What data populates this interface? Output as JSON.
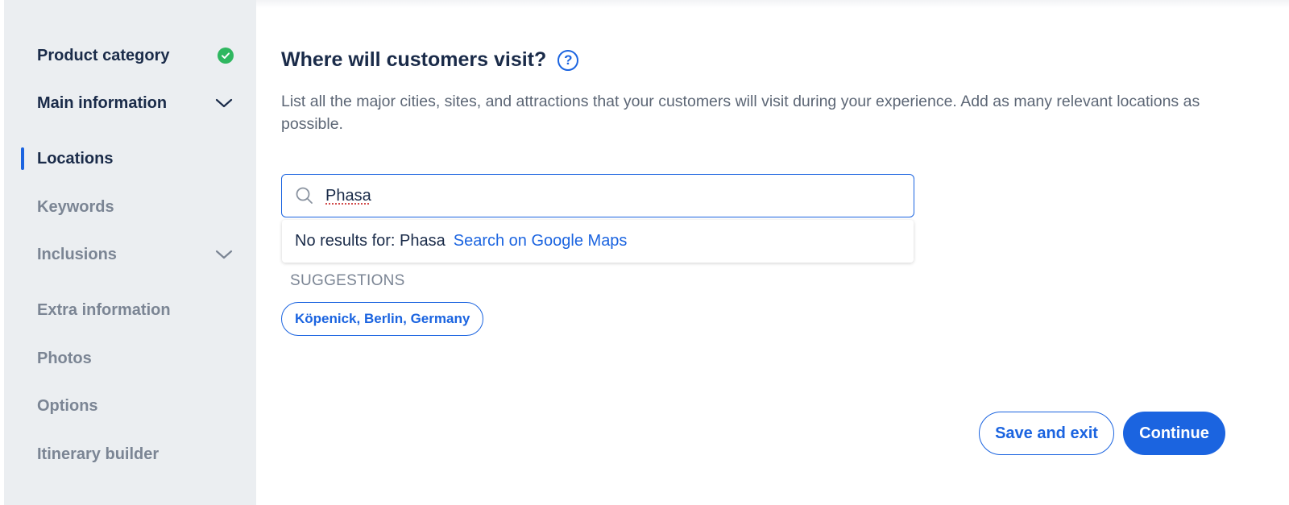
{
  "sidebar": {
    "items": [
      {
        "label": "Product category",
        "state": "done"
      },
      {
        "label": "Main information",
        "state": "expandable"
      },
      {
        "label": "Locations",
        "state": "active"
      },
      {
        "label": "Keywords",
        "state": "muted"
      },
      {
        "label": "Inclusions",
        "state": "expandable-muted"
      },
      {
        "label": "Extra information",
        "state": "muted"
      },
      {
        "label": "Photos",
        "state": "muted"
      },
      {
        "label": "Options",
        "state": "muted"
      },
      {
        "label": "Itinerary builder",
        "state": "muted"
      }
    ]
  },
  "main": {
    "title": "Where will customers visit?",
    "help_icon": "?",
    "description": "List all the major cities, sites, and attractions that your customers will visit during your experience. Add as many relevant locations as possible.",
    "search": {
      "value": "Phasa",
      "icon": "search-icon"
    },
    "dropdown": {
      "no_results_text": "No results for: Phasa",
      "link_text": "Search on Google Maps"
    },
    "suggestions": {
      "heading": "SUGGESTIONS",
      "chips": [
        "Köpenick, Berlin, Germany"
      ]
    }
  },
  "footer": {
    "save_label": "Save and exit",
    "continue_label": "Continue"
  },
  "colors": {
    "accent": "#1b64e0",
    "success": "#2fb760",
    "sidebar_bg": "#ebeef1",
    "text_dark": "#1a2b49",
    "text_muted": "#7b8594"
  }
}
